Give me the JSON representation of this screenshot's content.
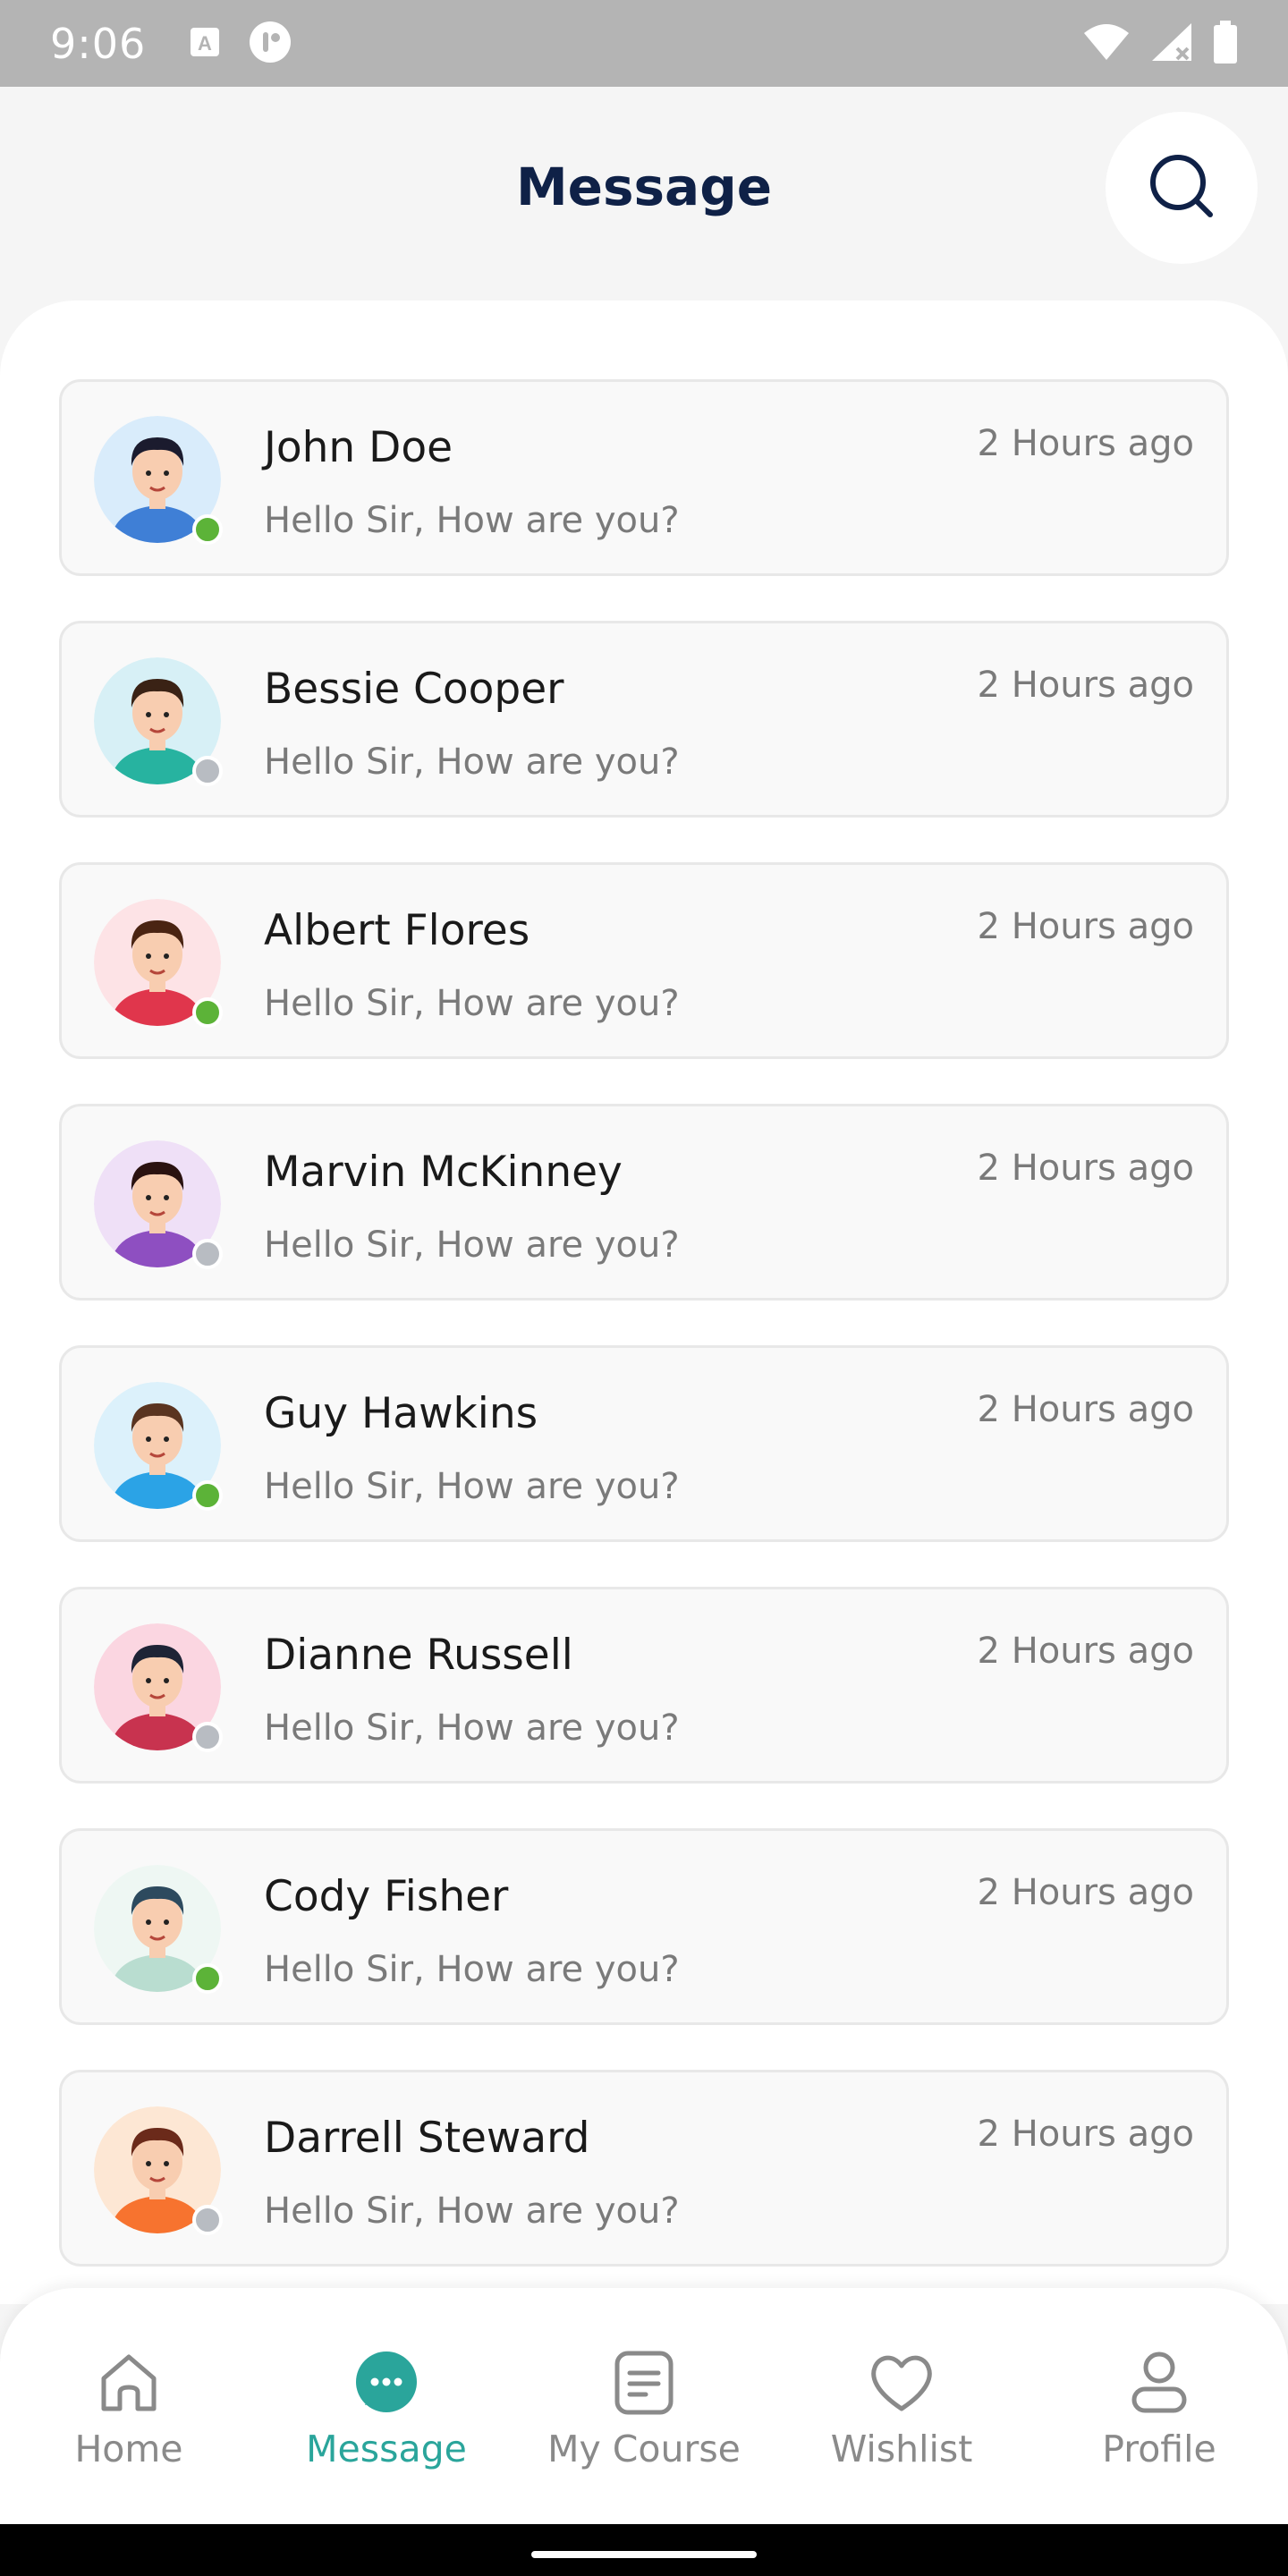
{
  "status_bar": {
    "time": "9:06",
    "left_icons": [
      "a-icon",
      "app-icon"
    ],
    "right_icons": [
      "wifi-icon",
      "signal-icon",
      "battery-icon"
    ]
  },
  "header": {
    "title": "Message",
    "search_icon": "search-icon"
  },
  "messages": [
    {
      "name": "John Doe",
      "preview": "Hello Sir, How are you?",
      "time": "2 Hours ago",
      "online": true,
      "avatar_bg": "#d9ecfb"
    },
    {
      "name": "Bessie Cooper",
      "preview": "Hello Sir, How are you?",
      "time": "2 Hours ago",
      "online": false,
      "avatar_bg": "#d7f0f6"
    },
    {
      "name": "Albert Flores",
      "preview": "Hello Sir, How are you?",
      "time": "2 Hours ago",
      "online": true,
      "avatar_bg": "#fde3e6"
    },
    {
      "name": "Marvin McKinney",
      "preview": "Hello Sir, How are you?",
      "time": "2 Hours ago",
      "online": false,
      "avatar_bg": "#efe0f7"
    },
    {
      "name": "Guy Hawkins",
      "preview": "Hello Sir, How are you?",
      "time": "2 Hours ago",
      "online": true,
      "avatar_bg": "#dcf1fb"
    },
    {
      "name": "Dianne Russell",
      "preview": "Hello Sir, How are you?",
      "time": "2 Hours ago",
      "online": false,
      "avatar_bg": "#fbd6e1"
    },
    {
      "name": "Cody Fisher",
      "preview": "Hello Sir, How are you?",
      "time": "2 Hours ago",
      "online": true,
      "avatar_bg": "#eef7f3"
    },
    {
      "name": "Darrell Steward",
      "preview": "Hello Sir, How are you?",
      "time": "2 Hours ago",
      "online": false,
      "avatar_bg": "#fde7d4"
    }
  ],
  "colors": {
    "online": "#5cb338",
    "offline": "#b8bcc2",
    "accent": "#2aa59b",
    "title": "#0f2147"
  },
  "bottom_nav": {
    "items": [
      {
        "label": "Home",
        "icon": "home-icon",
        "active": false
      },
      {
        "label": "Message",
        "icon": "chat-bubble-icon",
        "active": true
      },
      {
        "label": "My Course",
        "icon": "document-icon",
        "active": false
      },
      {
        "label": "Wishlist",
        "icon": "heart-icon",
        "active": false
      },
      {
        "label": "Profile",
        "icon": "user-icon",
        "active": false
      }
    ]
  }
}
